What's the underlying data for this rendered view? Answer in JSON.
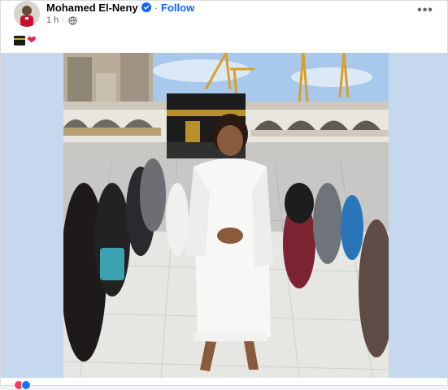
{
  "post": {
    "author": "Mohamed El-Neny",
    "follow_label": "Follow",
    "separator": "·",
    "time": "1 h",
    "meta_separator": "·",
    "caption_heart": "❤",
    "more_label": "•••",
    "photo_description_icon": "photo",
    "icons": {
      "verified": "verified-badge-icon",
      "privacy": "globe-icon",
      "menu": "more-options-icon"
    },
    "colors": {
      "follow": "#0866ff",
      "verified": "#0866ff",
      "background_band": "#c5d8ee"
    }
  }
}
